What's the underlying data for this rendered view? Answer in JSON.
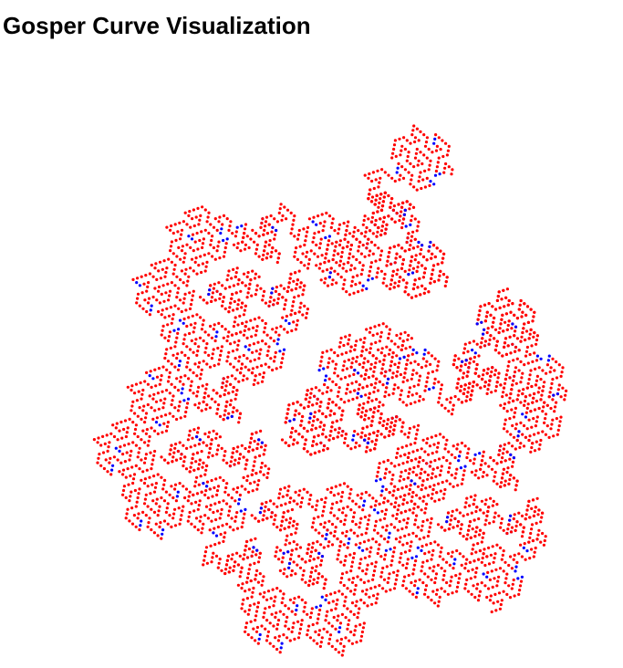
{
  "page": {
    "title": "Gosper Curve Visualization"
  },
  "visualization": {
    "name": "Gosper curve point cloud",
    "point_count": 4837,
    "colors": {
      "red": "#ff0000",
      "blue": "#0000ff",
      "background": "#ffffff"
    }
  }
}
